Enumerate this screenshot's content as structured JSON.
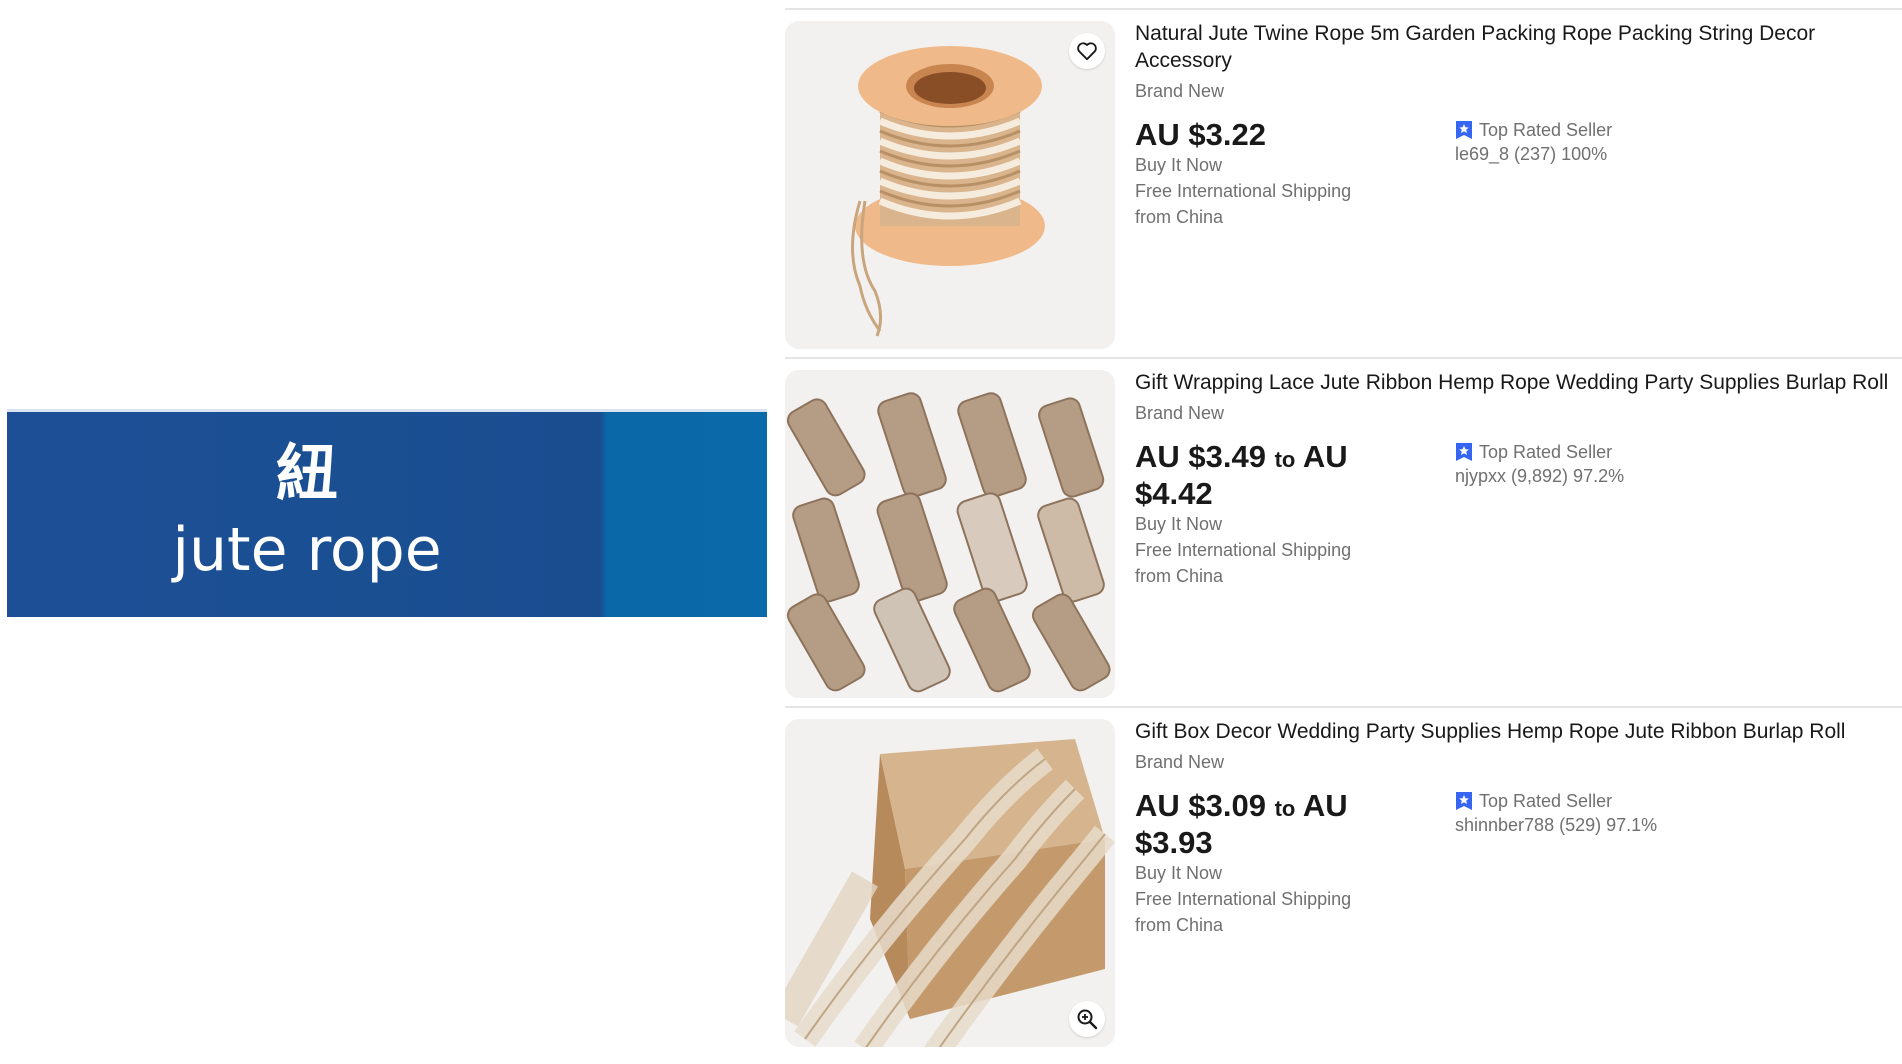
{
  "banner": {
    "kanji": "紐",
    "english": "jute rope"
  },
  "listings": [
    {
      "title": "Natural Jute Twine Rope 5m Garden Packing Rope Packing String Decor Accessory",
      "condition": "Brand New",
      "price": "AU $3.22",
      "price_to_word": "",
      "price_max": "",
      "buy_format": "Buy It Now",
      "shipping": "Free International Shipping",
      "origin": "from China",
      "seller_badge": "Top Rated Seller",
      "seller_info": "le69_8 (237) 100%",
      "image_button_icon": "heart-icon"
    },
    {
      "title": "Gift Wrapping Lace Jute Ribbon Hemp Rope Wedding Party Supplies Burlap Roll",
      "condition": "Brand New",
      "price": "AU $3.49",
      "price_to_word": "to",
      "price_max": "AU $4.42",
      "buy_format": "Buy It Now",
      "shipping": "Free International Shipping",
      "origin": "from China",
      "seller_badge": "Top Rated Seller",
      "seller_info": "njypxx (9,892) 97.2%",
      "image_button_icon": ""
    },
    {
      "title": "Gift Box Decor Wedding Party Supplies Hemp Rope Jute Ribbon Burlap Roll",
      "condition": "Brand New",
      "price": "AU $3.09",
      "price_to_word": "to",
      "price_max": "AU $3.93",
      "buy_format": "Buy It Now",
      "shipping": "Free International Shipping",
      "origin": "from China",
      "seller_badge": "Top Rated Seller",
      "seller_info": "shinnber788 (529) 97.1%",
      "image_button_icon": "zoom-in-icon"
    }
  ],
  "colors": {
    "banner_blue": "#1d4f96",
    "banner_right": "#0a69a9",
    "badge_blue": "#3665f3",
    "text_dark": "#191919",
    "text_muted": "#707070"
  }
}
